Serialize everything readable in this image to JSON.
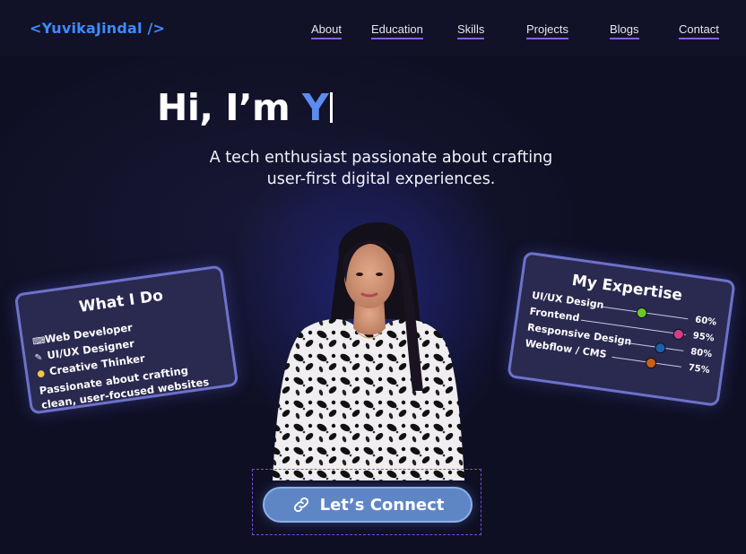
{
  "logo": "<YuvikaJindal />",
  "nav": [
    "About",
    "Education",
    "Skills",
    "Projects",
    "Blogs",
    "Contact"
  ],
  "hero": {
    "greeting": "Hi, I’m ",
    "typed": "Y",
    "subtitle_line1": "A tech enthusiast passionate about crafting",
    "subtitle_line2": "user-first digital experiences."
  },
  "what_i_do": {
    "title": "What I Do",
    "roles": [
      {
        "icon": "developer-icon",
        "label": "Web Developer"
      },
      {
        "icon": "palette-icon",
        "label": "UI/UX Designer"
      },
      {
        "icon": "lightbulb-icon",
        "label": "Creative Thinker"
      }
    ],
    "description": "Passionate about crafting clean, user-focused websites"
  },
  "expertise": {
    "title": "My Expertise",
    "skills": [
      {
        "name": "UI/UX Design",
        "level": "60%",
        "color": "#6cc62c"
      },
      {
        "name": "Frontend",
        "level": "95%",
        "color": "#d03f8e"
      },
      {
        "name": "Responsive Design",
        "level": "80%",
        "color": "#1d5fa8"
      },
      {
        "name": "Webflow / CMS",
        "level": "75%",
        "color": "#c9601a"
      }
    ]
  },
  "connect": {
    "label": "Let’s Connect",
    "icon": "link-icon"
  },
  "colors": {
    "accent": "#5b8cf0",
    "logo": "#3d8bff",
    "nav_underline": "#8b5cf6",
    "card_bg": "#2a2950",
    "button": "#5f86c4"
  }
}
